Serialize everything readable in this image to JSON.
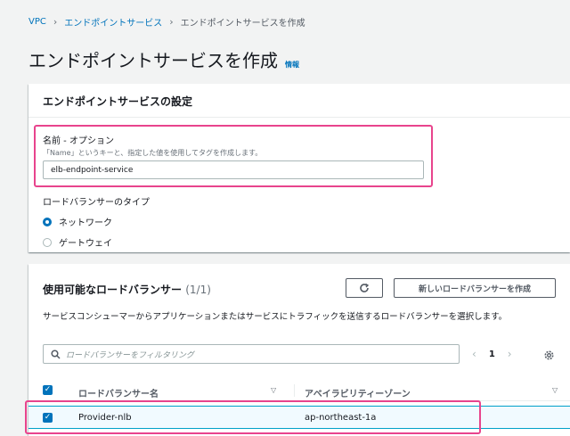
{
  "breadcrumb": {
    "items": [
      "VPC",
      "エンドポイントサービス",
      "エンドポイントサービスを作成"
    ],
    "separator": ">"
  },
  "page": {
    "title": "エンドポイントサービスを作成",
    "info": "情報"
  },
  "settings_panel": {
    "header": "エンドポイントサービスの設定",
    "name_label": "名前 - オプション",
    "name_description": "「Name」というキーと、指定した値を使用してタグを作成します。",
    "name_value": "elb-endpoint-service",
    "lb_type_label": "ロードバランサーのタイプ",
    "options": [
      {
        "label": "ネットワーク",
        "checked": true
      },
      {
        "label": "ゲートウェイ",
        "checked": false
      }
    ]
  },
  "lb_panel": {
    "header": "使用可能なロードバランサー",
    "count": "(1/1)",
    "new_button": "新しいロードバランサーを作成",
    "description": "サービスコンシューマーからアプリケーションまたはサービスにトラフィックを送信するロードバランサーを選択します。",
    "filter_placeholder": "ロードバランサーをフィルタリング",
    "page": "1",
    "columns": [
      "ロードバランサー名",
      "アベイラビリティーゾーン"
    ],
    "rows": [
      {
        "name": "Provider-nlb",
        "az": "ap-northeast-1a",
        "selected": true
      }
    ]
  },
  "colors": {
    "accent": "#0073bb",
    "highlight": "#e8448d",
    "background": "#f2f3f3"
  },
  "icons": [
    "chevron-right-icon",
    "refresh-icon",
    "search-icon",
    "chevron-left-icon",
    "gear-icon",
    "sort-down-icon",
    "check-icon"
  ]
}
